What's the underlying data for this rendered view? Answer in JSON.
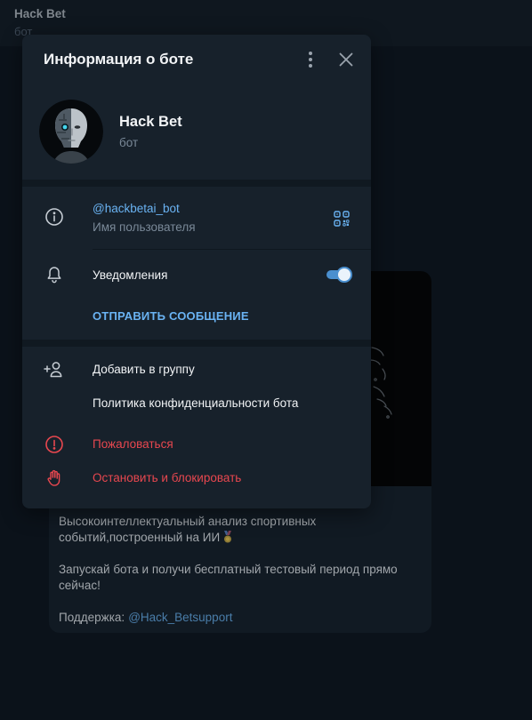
{
  "chat_header": {
    "title": "Hack Bet",
    "subtitle": "бот"
  },
  "message": {
    "paragraphs": [
      [
        "Высокоинтеллектуальный анализ спортивных",
        "событий,построенный на ИИ"
      ],
      [
        "Запускай бота и получи бесплатный тестовый период прямо",
        "сейчас!"
      ]
    ],
    "emoji_icon": "medal-icon",
    "support_label": "Поддержка:",
    "support_link": "@Hack_Betsupport"
  },
  "dialog": {
    "title": "Информация о боте",
    "menu_icon": "more-vertical-icon",
    "close_icon": "close-icon",
    "profile": {
      "name": "Hack Bet",
      "status": "бот",
      "avatar_icon": "robot-face-avatar"
    },
    "username": {
      "value": "@hackbetai_bot",
      "label": "Имя пользователя",
      "icon": "info-icon",
      "qr_icon": "qr-code-icon"
    },
    "notifications": {
      "label": "Уведомления",
      "icon": "bell-icon",
      "enabled": true
    },
    "send_message_label": "ОТПРАВИТЬ СООБЩЕНИЕ",
    "actions": [
      {
        "label": "Добавить в группу",
        "icon": "add-user-icon"
      },
      {
        "label": "Политика конфиденциальности бота",
        "icon": ""
      },
      {
        "label": "Пожаловаться",
        "icon": "report-icon"
      },
      {
        "label": "Остановить и блокировать",
        "icon": "stop-hand-icon"
      }
    ]
  },
  "colors": {
    "dialog_bg": "#17212b",
    "band": "#101921",
    "accent": "#6ab3f3",
    "danger": "#e8474f",
    "text": "#f2f4f6",
    "muted": "#7a8998",
    "icon": "#c5ccd3",
    "page_bg": "#0b121a"
  }
}
